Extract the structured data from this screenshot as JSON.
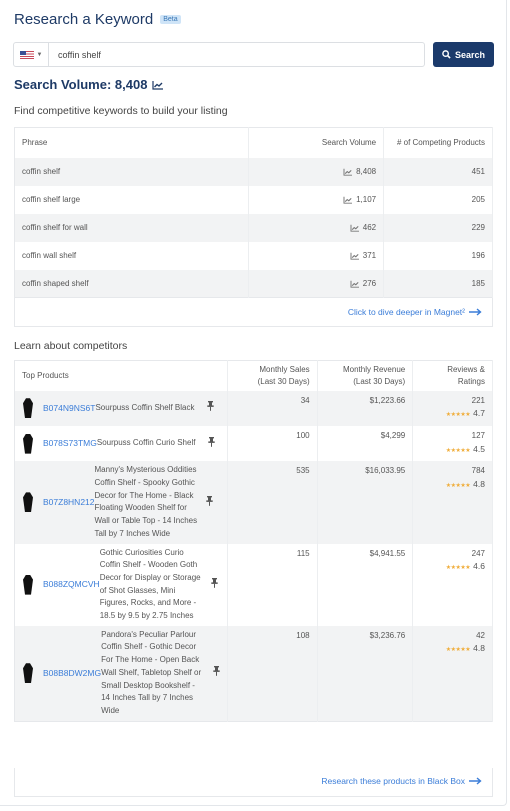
{
  "header": {
    "title": "Research a Keyword",
    "badge": "Beta"
  },
  "search": {
    "marketplace": "US",
    "value": "coffin shelf",
    "button_label": "Search"
  },
  "search_volume": {
    "label": "Search Volume: 8,408"
  },
  "keywords_section": {
    "heading": "Find competitive keywords to build your listing",
    "columns": [
      "Phrase",
      "Search Volume",
      "# of Competing Products"
    ],
    "rows": [
      {
        "phrase": "coffin shelf",
        "volume": "8,408",
        "competing": "451"
      },
      {
        "phrase": "coffin shelf large",
        "volume": "1,107",
        "competing": "205"
      },
      {
        "phrase": "coffin shelf for wall",
        "volume": "462",
        "competing": "229"
      },
      {
        "phrase": "coffin wall shelf",
        "volume": "371",
        "competing": "196"
      },
      {
        "phrase": "coffin shaped shelf",
        "volume": "276",
        "competing": "185"
      }
    ],
    "footer_link": "Click to dive deeper in Magnet²"
  },
  "competitors_section": {
    "heading": "Learn about competitors",
    "columns": {
      "products": "Top Products",
      "sales_l1": "Monthly Sales",
      "sales_l2": "(Last 30 Days)",
      "revenue_l1": "Monthly Revenue",
      "revenue_l2": "(Last 30 Days)",
      "reviews_l1": "Reviews &",
      "reviews_l2": "Ratings"
    },
    "rows": [
      {
        "asin": "B074N9NS6T",
        "name": "Sourpuss Coffin Shelf Black",
        "sales": "34",
        "revenue": "$1,223.66",
        "reviews": "221",
        "rating": "4.7"
      },
      {
        "asin": "B078S73TMG",
        "name": "Sourpuss Coffin Curio Shelf",
        "sales": "100",
        "revenue": "$4,299",
        "reviews": "127",
        "rating": "4.5"
      },
      {
        "asin": "B07Z8HN212",
        "name": "Manny's Mysterious Oddities Coffin Shelf - Spooky Gothic Decor for The Home - Black Floating Wooden Shelf for Wall or Table Top - 14 Inches Tall by 7 Inches Wide",
        "sales": "535",
        "revenue": "$16,033.95",
        "reviews": "784",
        "rating": "4.8"
      },
      {
        "asin": "B088ZQMCVH",
        "name": "Gothic Curiosities Curio Coffin Shelf - Wooden Goth Decor for Display or Storage of Shot Glasses, Mini Figures, Rocks, and More - 18.5 by 9.5 by 2.75 Inches",
        "sales": "115",
        "revenue": "$4,941.55",
        "reviews": "247",
        "rating": "4.6"
      },
      {
        "asin": "B08B8DW2MG",
        "name": "Pandora's Peculiar Parlour Coffin Shelf - Gothic Decor For The Home - Open Back Wall Shelf, Tabletop Shelf or Small Desktop Bookshelf - 14 Inches Tall by 7 Inches Wide",
        "sales": "108",
        "revenue": "$3,236.76",
        "reviews": "42",
        "rating": "4.8"
      }
    ],
    "footer_link": "Research these products in Black Box"
  },
  "icons": {
    "trend": "trend-chart-icon",
    "pin": "pin-icon",
    "search": "magnifier-icon",
    "arrow": "arrow-right-icon",
    "stars": "star-rating-icon"
  },
  "colors": {
    "brand": "#1b3a6b",
    "link": "#3b7dd8",
    "stars": "#f0ad3a"
  }
}
